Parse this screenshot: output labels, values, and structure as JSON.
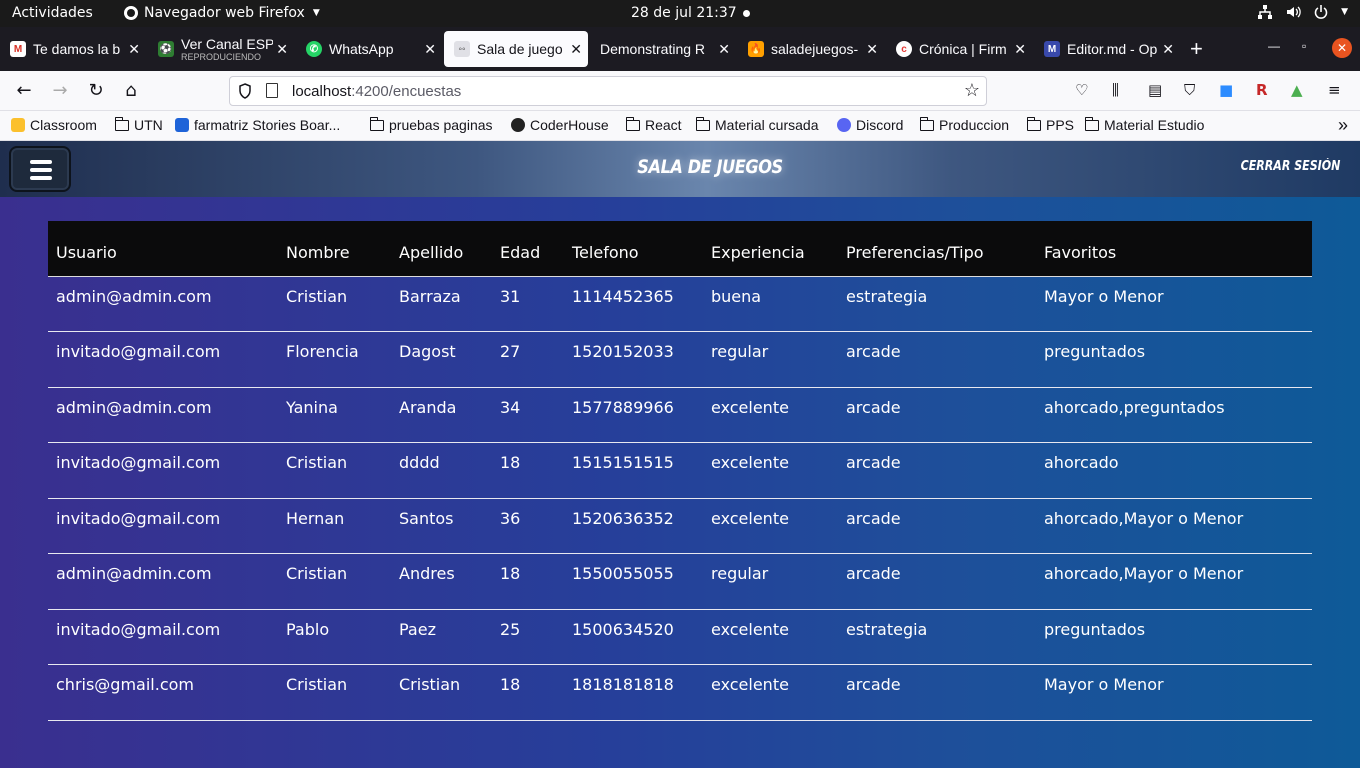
{
  "system_bar": {
    "activities": "Actividades",
    "app_name": "Navegador web Firefox",
    "clock": "28 de jul  21:37"
  },
  "tabs": [
    {
      "title": "Te damos la b",
      "favicon_color": "#d93025",
      "favicon": "gmail-icon"
    },
    {
      "title": "Ver Canal ESP",
      "subtitle": "REPRODUCIENDO",
      "favicon_color": "#2e7d32",
      "favicon": "soccer-icon"
    },
    {
      "title": "WhatsApp",
      "favicon_color": "#25d366",
      "favicon": "whatsapp-icon"
    },
    {
      "title": "Sala de juego",
      "favicon_color": "#cccccc",
      "favicon": "controller-icon",
      "active": true
    },
    {
      "title": "Demonstrating R",
      "favicon_color": "#1c1b22",
      "favicon": "blank-icon"
    },
    {
      "title": "saladejuegos-",
      "favicon_color": "#ffa000",
      "favicon": "firebase-icon"
    },
    {
      "title": "Crónica | Firm",
      "favicon_color": "#e53935",
      "favicon": "cronica-icon"
    },
    {
      "title": "Editor.md - Op",
      "favicon_color": "#3949ab",
      "favicon": "editor-icon"
    }
  ],
  "navbar": {
    "url_host": "localhost",
    "url_path": ":4200/encuestas"
  },
  "bookmarks": [
    {
      "label": "Classroom",
      "type": "classroom"
    },
    {
      "label": "UTN",
      "type": "folder"
    },
    {
      "label": "farmatriz Stories Boar...",
      "type": "jira"
    },
    {
      "label": "pruebas paginas",
      "type": "folder"
    },
    {
      "label": "CoderHouse",
      "type": "coder"
    },
    {
      "label": "React",
      "type": "folder"
    },
    {
      "label": "Material cursada",
      "type": "folder"
    },
    {
      "label": "Discord",
      "type": "discord"
    },
    {
      "label": "Produccion",
      "type": "folder"
    },
    {
      "label": "PPS",
      "type": "folder"
    },
    {
      "label": "Material Estudio",
      "type": "folder"
    }
  ],
  "app": {
    "title": "SALA DE JUEGOS",
    "logout": "CERRAR SESIÓN"
  },
  "table": {
    "headers": [
      "Usuario",
      "Nombre",
      "Apellido",
      "Edad",
      "Telefono",
      "Experiencia",
      "Preferencias/Tipo",
      "Favoritos"
    ],
    "rows": [
      [
        "admin@admin.com",
        "Cristian",
        "Barraza",
        "31",
        "1114452365",
        "buena",
        "estrategia",
        "Mayor o Menor"
      ],
      [
        "invitado@gmail.com",
        "Florencia",
        "Dagost",
        "27",
        "1520152033",
        "regular",
        "arcade",
        "preguntados"
      ],
      [
        "admin@admin.com",
        "Yanina",
        "Aranda",
        "34",
        "1577889966",
        "excelente",
        "arcade",
        "ahorcado,preguntados"
      ],
      [
        "invitado@gmail.com",
        "Cristian",
        "dddd",
        "18",
        "1515151515",
        "excelente",
        "arcade",
        "ahorcado"
      ],
      [
        "invitado@gmail.com",
        "Hernan",
        "Santos",
        "36",
        "1520636352",
        "excelente",
        "arcade",
        "ahorcado,Mayor o Menor"
      ],
      [
        "admin@admin.com",
        "Cristian",
        "Andres",
        "18",
        "1550055055",
        "regular",
        "arcade",
        "ahorcado,Mayor o Menor"
      ],
      [
        "invitado@gmail.com",
        "Pablo",
        "Paez",
        "25",
        "1500634520",
        "excelente",
        "estrategia",
        "preguntados"
      ],
      [
        "chris@gmail.com",
        "Cristian",
        "Cristian",
        "18",
        "1818181818",
        "excelente",
        "arcade",
        "Mayor o Menor"
      ]
    ]
  }
}
